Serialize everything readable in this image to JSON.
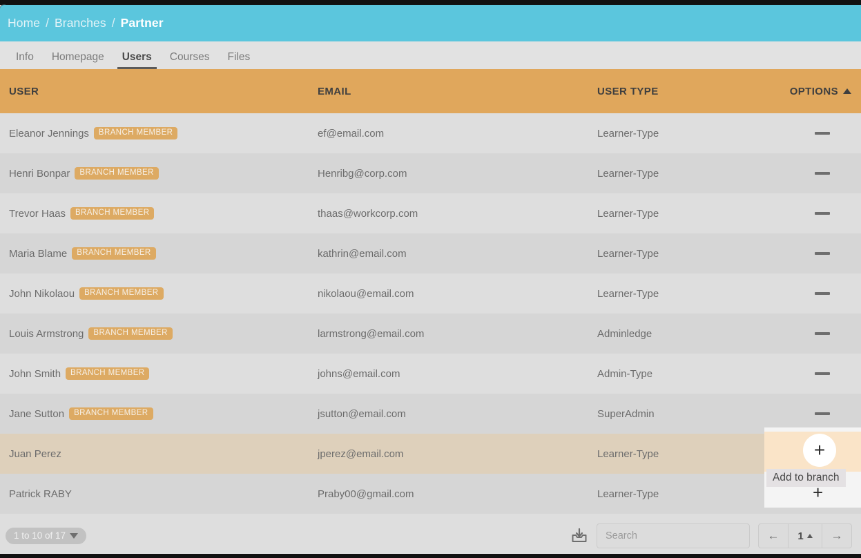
{
  "breadcrumb": {
    "items": [
      "Home",
      "Branches"
    ],
    "current": "Partner",
    "separator": "/"
  },
  "tabs": [
    {
      "label": "Info",
      "active": false
    },
    {
      "label": "Homepage",
      "active": false
    },
    {
      "label": "Users",
      "active": true
    },
    {
      "label": "Courses",
      "active": false
    },
    {
      "label": "Files",
      "active": false
    }
  ],
  "table": {
    "columns": [
      "USER",
      "EMAIL",
      "USER TYPE",
      "OPTIONS"
    ],
    "sort_column": "OPTIONS",
    "sort_direction": "asc",
    "badge_label": "BRANCH MEMBER",
    "rows": [
      {
        "user": "Eleanor Jennings",
        "badge": true,
        "email": "ef@email.com",
        "type": "Learner-Type",
        "option": "dash",
        "highlight": false
      },
      {
        "user": "Henri Bonpar",
        "badge": true,
        "email": "Henribg@corp.com",
        "type": "Learner-Type",
        "option": "dash",
        "highlight": false
      },
      {
        "user": "Trevor Haas",
        "badge": true,
        "email": "thaas@workcorp.com",
        "type": "Learner-Type",
        "option": "dash",
        "highlight": false
      },
      {
        "user": "Maria Blame",
        "badge": true,
        "email": "kathrin@email.com",
        "type": "Learner-Type",
        "option": "dash",
        "highlight": false
      },
      {
        "user": "John Nikolaou",
        "badge": true,
        "email": "nikolaou@email.com",
        "type": "Learner-Type",
        "option": "dash",
        "highlight": false
      },
      {
        "user": "Louis Armstrong",
        "badge": true,
        "email": "larmstrong@email.com",
        "type": "Adminledge",
        "option": "dash",
        "highlight": false
      },
      {
        "user": "John Smith",
        "badge": true,
        "email": "johns@email.com",
        "type": "Admin-Type",
        "option": "dash",
        "highlight": false
      },
      {
        "user": "Jane Sutton",
        "badge": true,
        "email": "jsutton@email.com",
        "type": "SuperAdmin",
        "option": "dash",
        "highlight": false
      },
      {
        "user": "Juan Perez",
        "badge": false,
        "email": "jperez@email.com",
        "type": "Learner-Type",
        "option": "plus",
        "highlight": true
      },
      {
        "user": "Patrick RABY",
        "badge": false,
        "email": "Praby00@gmail.com",
        "type": "Learner-Type",
        "option": "plus",
        "highlight": false
      }
    ]
  },
  "tooltip": {
    "text": "Add to branch"
  },
  "footer": {
    "count_label": "1 to 10 of 17",
    "export_icon": "download-tray-icon",
    "search_placeholder": "Search",
    "search_value": "",
    "prev_label": "←",
    "page_number": "1",
    "next_label": "→"
  },
  "colors": {
    "breadcrumb_bg": "#5bc6dd",
    "header_bg": "#e0a75c",
    "badge_bg": "#ddaa63",
    "row_odd": "#dedede",
    "row_even": "#d6d6d6",
    "row_highlight": "#ded0bb"
  }
}
